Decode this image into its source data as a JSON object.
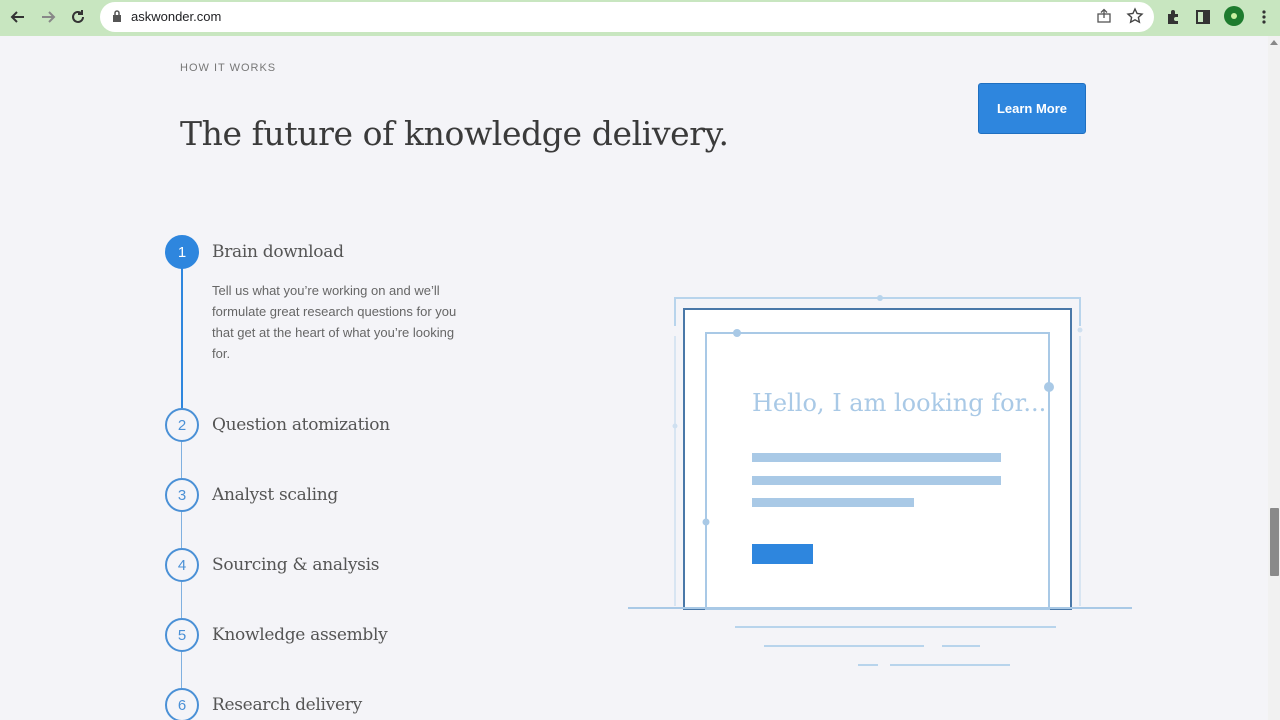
{
  "browser": {
    "url": "askwonder.com",
    "toolbar_color": "#c8e6c0"
  },
  "section": {
    "eyebrow": "HOW IT WORKS",
    "headline": "The future of knowledge delivery.",
    "cta_label": "Learn More",
    "accent_color": "#2e86de"
  },
  "steps": [
    {
      "number": "1",
      "title": "Brain download",
      "description": "Tell us what you’re working on and we’ll formulate great research questions for you that get at the heart of what you’re looking for.",
      "active": true
    },
    {
      "number": "2",
      "title": "Question atomization"
    },
    {
      "number": "3",
      "title": "Analyst scaling"
    },
    {
      "number": "4",
      "title": "Sourcing & analysis"
    },
    {
      "number": "5",
      "title": "Knowledge assembly"
    },
    {
      "number": "6",
      "title": "Research delivery"
    }
  ],
  "illustration": {
    "prompt_text": "Hello, I  am looking for..."
  }
}
